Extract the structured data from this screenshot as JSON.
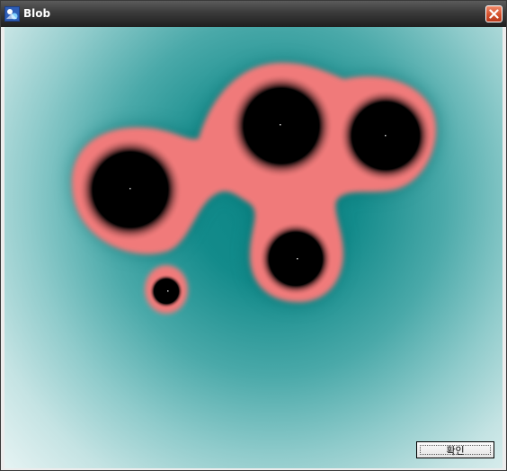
{
  "window": {
    "title": "Blob",
    "app_icon": "blob-app-icon",
    "close_icon": "close-icon"
  },
  "canvas": {
    "description_colors": {
      "background_inner": "#0a8585",
      "background_outer": "#e8f4f4",
      "blob_fill": "#f07a7a",
      "blob_core": "#000000"
    }
  },
  "dialog": {
    "ok_label": "확인"
  }
}
